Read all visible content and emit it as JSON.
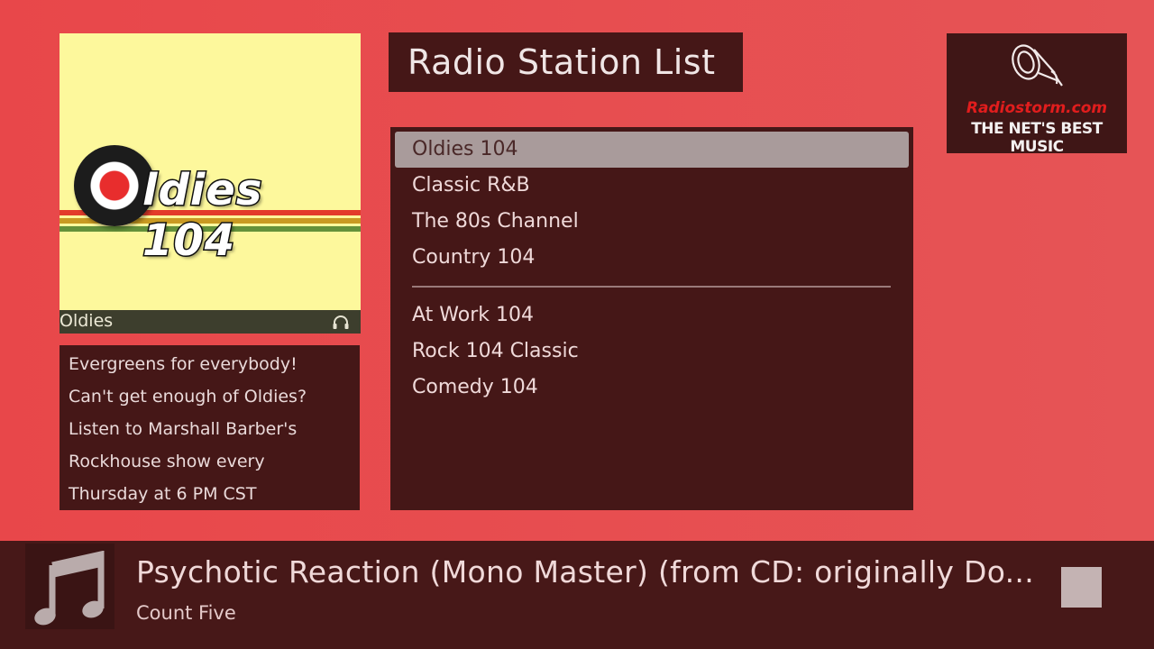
{
  "colors": {
    "background": "#e8474a",
    "panel": "#451717",
    "selection": "#a99b9b",
    "art_background": "#fdf89c",
    "brand_red": "#e11d1d"
  },
  "header": {
    "title": "Radio Station List"
  },
  "current_station": {
    "logo_text": "ldies 104",
    "caption": "Oldies",
    "caption_icon": "headphones-icon",
    "description_lines": [
      "Evergreens for everybody!",
      "Can't get enough of Oldies?",
      "Listen to Marshall Barber's",
      "Rockhouse show every",
      "Thursday at 6 PM CST"
    ]
  },
  "brand": {
    "icon": "speaker-logo-icon",
    "site": "Radiostorm.com",
    "tagline": "THE NET'S BEST MUSIC"
  },
  "stations": {
    "selected_index": 0,
    "group1": [
      "Oldies 104",
      "Classic R&B",
      "The 80s Channel",
      "Country 104"
    ],
    "group2": [
      "At Work 104",
      "Rock 104 Classic",
      "Comedy 104"
    ]
  },
  "now_playing": {
    "thumb_icon": "music-note-icon",
    "title": "Psychotic Reaction (Mono Master) (from CD: originally Do...",
    "artist": "Count Five",
    "control_icon": "stop-icon"
  }
}
